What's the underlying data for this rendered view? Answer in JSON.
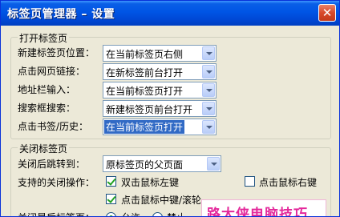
{
  "window": {
    "title": "标签页管理器 – 设置"
  },
  "open_group": {
    "legend": "打开标签页",
    "rows": [
      {
        "label": "新建标签页位置：",
        "value": "在当前标签页右侧"
      },
      {
        "label": "点击网页链接：",
        "value": "在新标签前台打开"
      },
      {
        "label": "地址栏输入：",
        "value": "在当前标签页打开"
      },
      {
        "label": "搜索框搜索：",
        "value": "新建标签页前台打开"
      },
      {
        "label": "点击书签/历史：",
        "value": "在当前标签页打开"
      }
    ]
  },
  "close_group": {
    "legend": "关闭标签页",
    "jump_label": "关闭后跳转到：",
    "jump_value": "原标签页的父页面",
    "ops_label": "支持的关闭操作：",
    "ops": [
      {
        "label": "双击鼠标左键",
        "checked": true
      },
      {
        "label": "点击鼠标右键",
        "checked": false
      },
      {
        "label": "点击鼠标中键/滚轮",
        "checked": true
      }
    ],
    "last_label": "关闭最后标签页：",
    "last_options": [
      {
        "label": "允许",
        "selected": true
      },
      {
        "label": "禁止",
        "selected": false
      }
    ]
  },
  "watermark": {
    "text": "路大侠电脑技巧"
  }
}
